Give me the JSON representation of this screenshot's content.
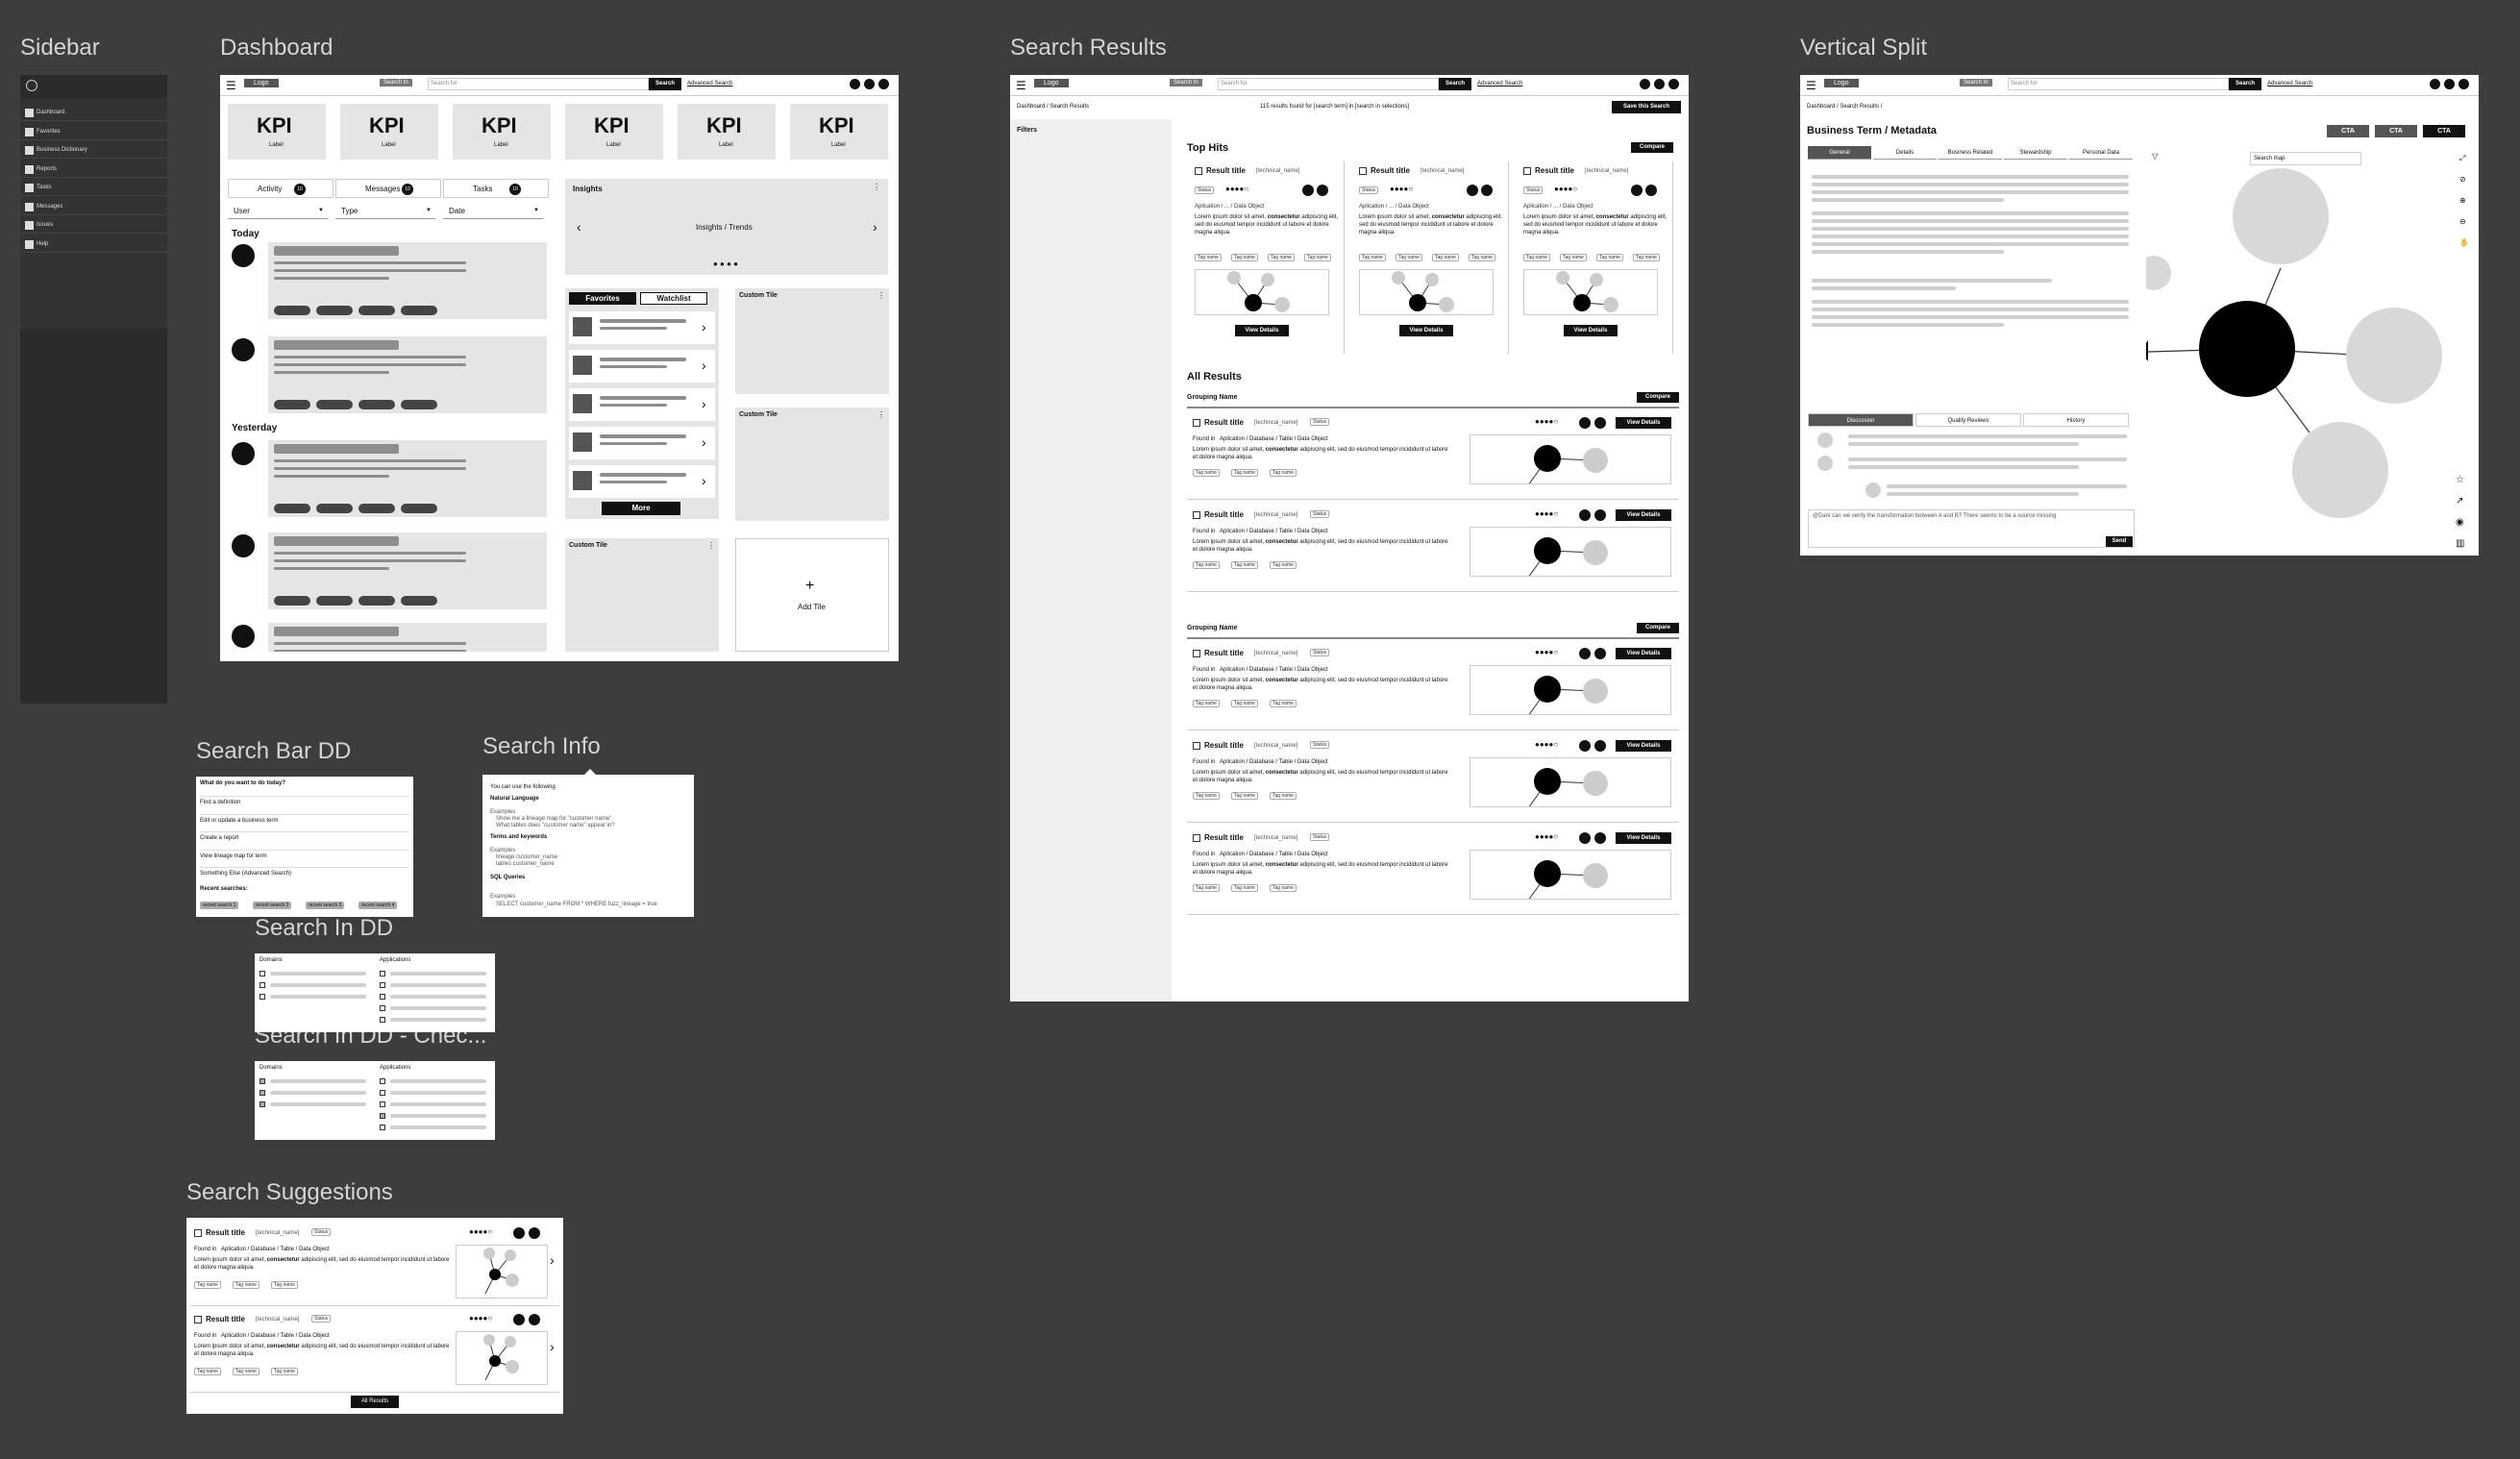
{
  "section_labels": {
    "sidebar": "Sidebar",
    "dashboard": "Dashboard",
    "search_results": "Search Results",
    "vertical_split": "Vertical Split",
    "search_bar_dd": "Search Bar DD",
    "search_info": "Search Info",
    "search_in_dd": "Search In DD",
    "search_in_dd_check": "Search In DD - Chec...",
    "search_suggestions": "Search Suggestions"
  },
  "sidebar": {
    "items": [
      "Dashboard",
      "Favorites",
      "Business Dictionary",
      "Reports",
      "Tasks",
      "Messages",
      "Issues",
      "Help"
    ]
  },
  "topbar": {
    "logo": "Logo",
    "search_in": "Search In",
    "search_placeholder": "Search for",
    "search_button": "Search",
    "advanced_search": "Advanced Search"
  },
  "dashboard": {
    "kpis": [
      {
        "value": "KPI",
        "label": "Label"
      },
      {
        "value": "KPI",
        "label": "Label"
      },
      {
        "value": "KPI",
        "label": "Label"
      },
      {
        "value": "KPI",
        "label": "Label"
      },
      {
        "value": "KPI",
        "label": "Label"
      },
      {
        "value": "KPI",
        "label": "Label"
      }
    ],
    "tabs": [
      {
        "label": "Activity",
        "count": "10"
      },
      {
        "label": "Messages",
        "count": "10"
      },
      {
        "label": "Tasks",
        "count": "10"
      }
    ],
    "filters": [
      "User",
      "Type",
      "Date"
    ],
    "today": "Today",
    "yesterday": "Yesterday",
    "insights_title": "Insights",
    "insights_body": "Insights / Trends",
    "fav_tab": "Favorites",
    "watch_tab": "Watchlist",
    "more": "More",
    "custom_tile": "Custom Tile",
    "add_tile": "Add Tile",
    "plus": "+"
  },
  "search_results": {
    "breadcrumb": "Dashboard  /  Search Results",
    "count_text": "115 results found for [search term] in [search in selections]",
    "save": "Save this Search",
    "filters": "Filters",
    "top_hits": "Top Hits",
    "compare": "Compare",
    "all_results": "All Results",
    "grouping": "Grouping Name",
    "result_title": "Result title",
    "tech_name": "[technical_name]",
    "status": "Status",
    "found_in": "Found in",
    "path": "Aplication  /  Database  /  Table  /  Data Object",
    "lorem_a": "Lorem ipsum dolor sit amet,",
    "lorem_bold": "consectetur",
    "lorem_b": "adipiscing elit, sed do eiusmod tempor incididunt ut labore et dolore magna aliqua.",
    "tag": "Tag name",
    "view_details": "View Details",
    "top_path": "Aplication  /  ...  /  Data Object"
  },
  "vertical_split": {
    "breadcrumb": "Dashboard  /  Search Results  /",
    "title": "Business Term / Metadata",
    "ctas": [
      "CTA",
      "CTA",
      "CTA"
    ],
    "tabs": [
      "General",
      "Details",
      "Business Related",
      "Stewardship",
      "Personal Data"
    ],
    "search_map": "Search map",
    "bottom_tabs": [
      "Discussion",
      "Quality Reviews",
      "History"
    ],
    "comment": "@Dani can we verify the transformation between A and B? There seems to be a source missing",
    "send": "Send"
  },
  "search_bar_dd": {
    "title": "What do you want to do today?",
    "items": [
      "Find a definition",
      "Edit or update a business term",
      "Create a report",
      "View lineage map for term",
      "Something Else (Advanced Search)"
    ],
    "recent_title": "Recent searches:",
    "recent": [
      "recent search 1",
      "recent search 2",
      "recent search 3",
      "recent search 4"
    ]
  },
  "search_info": {
    "intro": "You can use the following",
    "h1": "Natural Language",
    "ex": "Examples",
    "nl1": "Show me a lineage map for \"customer name\"",
    "nl2": "What tables does \"customer name\" appear in?",
    "h2": "Terms and keywords",
    "tk1": "lineage customer_name",
    "tk2": "tables customer_name",
    "h3": "SQL Queries",
    "sql1": "SELECT customer_name FROM * WHERE fuzz_lineage = true"
  },
  "search_in": {
    "col1": "Domains",
    "col2": "Applications"
  },
  "suggestions": {
    "all_results": "All Results"
  }
}
